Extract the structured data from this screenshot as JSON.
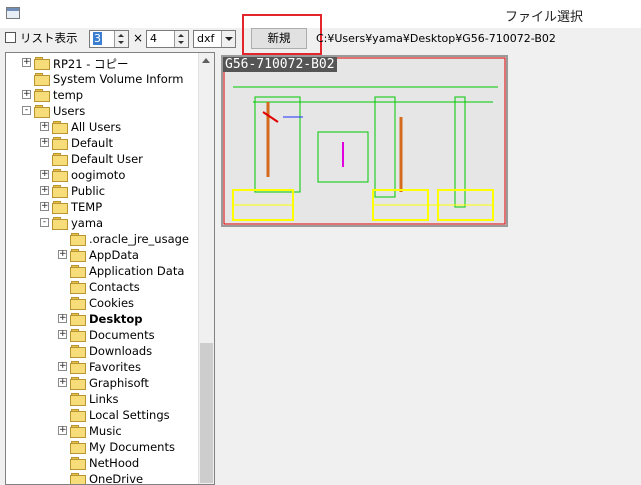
{
  "window": {
    "title": "ファイル選択",
    "icon": "app-window-icon"
  },
  "toolbar": {
    "list_view_label": "リスト表示",
    "list_view_checked": false,
    "columns_value": "3",
    "times_symbol": "×",
    "rows_value": "4",
    "extension_value": "dxf",
    "new_button_label": "新規",
    "current_path": "C:¥Users¥yama¥Desktop¥G56-710072-B02"
  },
  "tree": {
    "items": [
      {
        "label": "RP21 - コピー",
        "expander": "+"
      },
      {
        "label": "System Volume Inform",
        "expander": ""
      },
      {
        "label": "temp",
        "expander": "+"
      },
      {
        "label": "Users",
        "expander": "-"
      },
      {
        "label": "All Users",
        "expander": "+"
      },
      {
        "label": "Default",
        "expander": "+"
      },
      {
        "label": "Default User",
        "expander": ""
      },
      {
        "label": "oogimoto",
        "expander": "+"
      },
      {
        "label": "Public",
        "expander": "+"
      },
      {
        "label": "TEMP",
        "expander": "+"
      },
      {
        "label": "yama",
        "expander": "-"
      },
      {
        "label": ".oracle_jre_usage",
        "expander": ""
      },
      {
        "label": "AppData",
        "expander": "+"
      },
      {
        "label": "Application Data",
        "expander": ""
      },
      {
        "label": "Contacts",
        "expander": ""
      },
      {
        "label": "Cookies",
        "expander": ""
      },
      {
        "label": "Desktop",
        "expander": "+"
      },
      {
        "label": "Documents",
        "expander": "+"
      },
      {
        "label": "Downloads",
        "expander": ""
      },
      {
        "label": "Favorites",
        "expander": "+"
      },
      {
        "label": "Graphisoft",
        "expander": "+"
      },
      {
        "label": "Links",
        "expander": ""
      },
      {
        "label": "Local Settings",
        "expander": ""
      },
      {
        "label": "Music",
        "expander": "+"
      },
      {
        "label": "My Documents",
        "expander": ""
      },
      {
        "label": "NetHood",
        "expander": ""
      },
      {
        "label": "OneDrive",
        "expander": ""
      }
    ],
    "selected_label": "Desktop"
  },
  "preview": {
    "file_label": "G56-710072-B02",
    "colors": {
      "cad_green": "#00c800",
      "cad_yellow": "#ffff00",
      "cad_orange": "#d46a1c",
      "cad_red": "#e00000",
      "cad_magenta": "#e000e0",
      "cad_blue": "#2030ff",
      "highlight": "#e2262c"
    }
  }
}
